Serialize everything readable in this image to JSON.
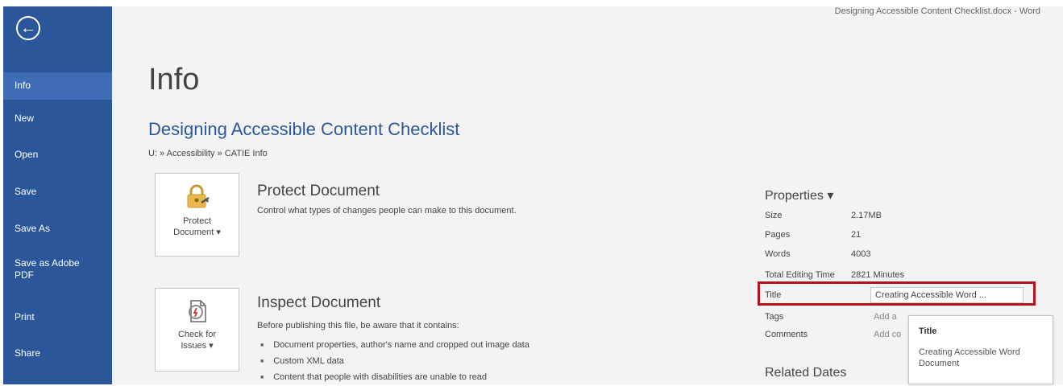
{
  "window": {
    "title": "Designing Accessible Content Checklist.docx - Word"
  },
  "sidebar": {
    "back_icon": "arrow-left-circle-icon",
    "items": [
      {
        "label": "Info",
        "active": true
      },
      {
        "label": "New"
      },
      {
        "label": "Open"
      },
      {
        "label": "Save"
      },
      {
        "label": "Save As"
      },
      {
        "label": "Save as Adobe PDF"
      },
      {
        "label": "Print"
      },
      {
        "label": "Share"
      }
    ],
    "colors": {
      "background": "#2b579a",
      "active": "#3e6db5"
    }
  },
  "main": {
    "heading": "Info",
    "document_title": "Designing Accessible Content Checklist",
    "breadcrumb": "U: » Accessibility » CATIE Info",
    "protect": {
      "button_line1": "Protect",
      "button_line2": "Document ▾",
      "icon": "lock-key-icon",
      "title": "Protect Document",
      "description": "Control what types of changes people can make to this document."
    },
    "inspect": {
      "button_line1": "Check for",
      "button_line2": "Issues ▾",
      "icon": "document-inspect-icon",
      "title": "Inspect Document",
      "description": "Before publishing this file, be aware that it contains:",
      "bullets": [
        "Document properties, author's name and cropped out image data",
        "Custom XML data",
        "Content that people with disabilities are unable to read"
      ]
    }
  },
  "properties": {
    "header": "Properties ▾",
    "rows": [
      {
        "label": "Size",
        "value": "2.17MB"
      },
      {
        "label": "Pages",
        "value": "21"
      },
      {
        "label": "Words",
        "value": "4003"
      },
      {
        "label": "Total Editing Time",
        "value": "2821 Minutes"
      },
      {
        "label": "Title",
        "value": "Creating Accessible Word ..."
      },
      {
        "label": "Tags",
        "value": "Add a"
      },
      {
        "label": "Comments",
        "value": "Add co"
      }
    ],
    "highlight_color": "#b5121b",
    "tooltip": {
      "heading": "Title",
      "body": "Creating Accessible Word Document"
    },
    "related_dates": "Related Dates"
  }
}
